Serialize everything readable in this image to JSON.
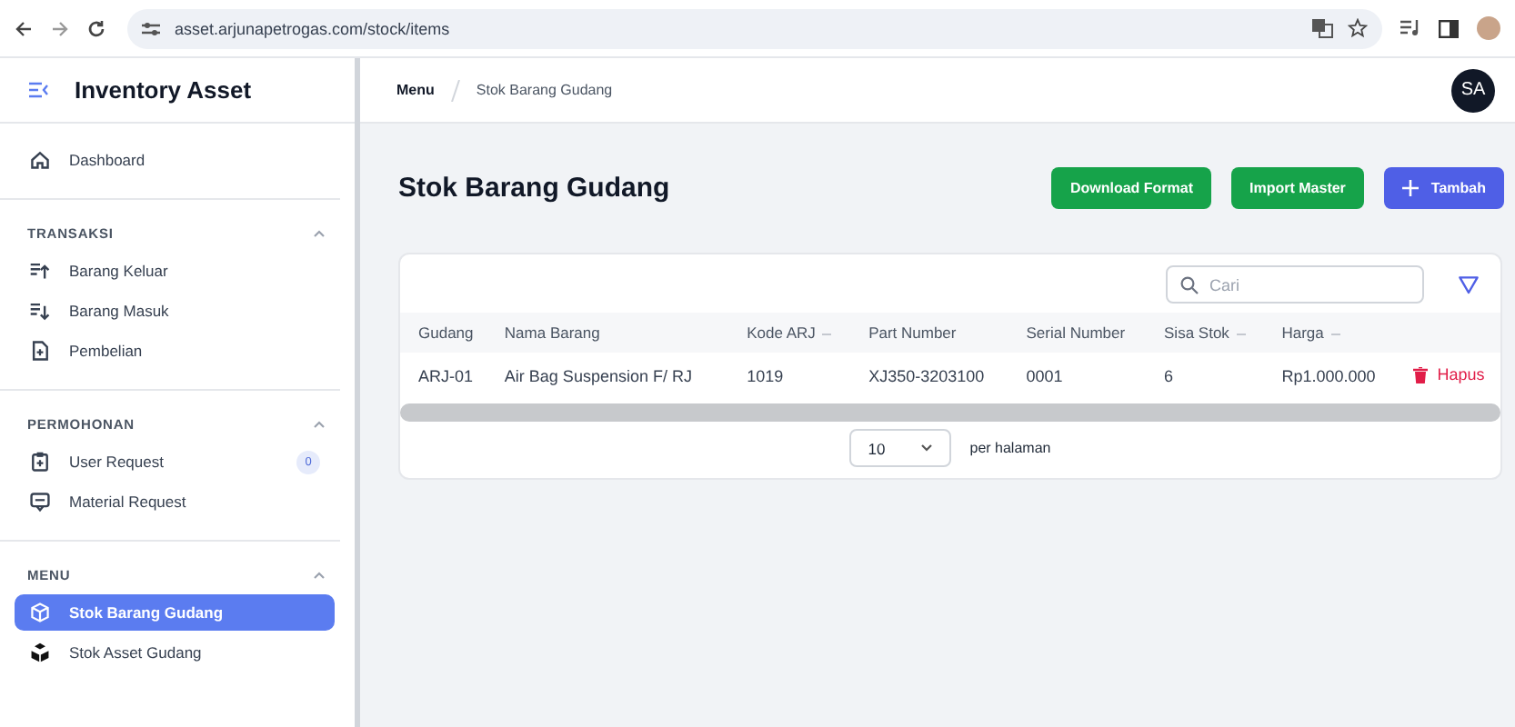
{
  "browser": {
    "url": "asset.arjunapetrogas.com/stock/items"
  },
  "sidebar": {
    "title": "Inventory Asset",
    "sections": [
      {
        "items": [
          {
            "label": "Dashboard",
            "selected": false
          }
        ]
      },
      {
        "heading": "TRANSAKSI",
        "expanded": true,
        "items": [
          {
            "label": "Barang Keluar",
            "selected": false
          },
          {
            "label": "Barang Masuk",
            "selected": false
          },
          {
            "label": "Pembelian",
            "selected": false
          }
        ]
      },
      {
        "heading": "PERMOHONAN",
        "expanded": true,
        "items": [
          {
            "label": "User Request",
            "selected": false,
            "badge": "0"
          },
          {
            "label": "Material Request",
            "selected": false
          }
        ]
      },
      {
        "heading": "MENU",
        "expanded": true,
        "items": [
          {
            "label": "Stok Barang Gudang",
            "selected": true
          },
          {
            "label": "Stok Asset Gudang",
            "selected": false
          }
        ]
      }
    ]
  },
  "header": {
    "breadcrumb": [
      "Menu",
      "Stok Barang Gudang"
    ],
    "avatar": "SA"
  },
  "page": {
    "title": "Stok Barang Gudang",
    "buttons": [
      {
        "label": "Download Format",
        "kind": "secondary"
      },
      {
        "label": "Import Master",
        "kind": "secondary"
      },
      {
        "label": "Tambah",
        "kind": "primary"
      }
    ]
  },
  "table": {
    "search": {
      "placeholder": "Cari"
    },
    "columns": [
      {
        "label": "Gudang",
        "sortable": false
      },
      {
        "label": "Nama Barang",
        "sortable": false
      },
      {
        "label": "Kode ARJ",
        "sortable": true
      },
      {
        "label": "Part Number",
        "sortable": false
      },
      {
        "label": "Serial Number",
        "sortable": false
      },
      {
        "label": "Sisa Stok",
        "sortable": true
      },
      {
        "label": "Harga",
        "sortable": true
      }
    ],
    "rows": [
      {
        "cells": [
          "ARJ-01",
          "Air Bag Suspension F/ RJ",
          "1019",
          "XJ350-3203100",
          "0001",
          "6",
          "Rp1.000.000"
        ],
        "action": "Hapus"
      }
    ],
    "pagination": {
      "page_size": "10",
      "label": "per halaman"
    }
  }
}
